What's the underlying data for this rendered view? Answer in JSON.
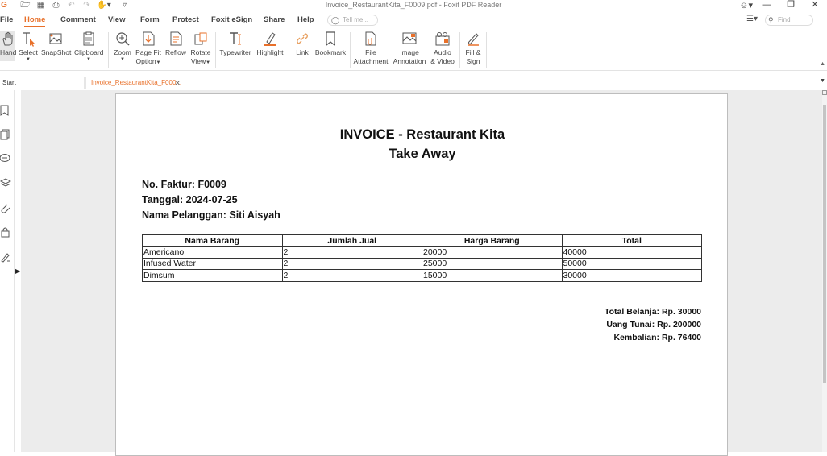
{
  "window": {
    "title": "Invoice_RestaurantKita_F0009.pdf - Foxit PDF Reader"
  },
  "menu": {
    "tabs": [
      {
        "label": "File"
      },
      {
        "label": "Home"
      },
      {
        "label": "Comment"
      },
      {
        "label": "View"
      },
      {
        "label": "Form"
      },
      {
        "label": "Protect"
      },
      {
        "label": "Foxit eSign"
      },
      {
        "label": "Share"
      },
      {
        "label": "Help"
      }
    ],
    "tell_me_placeholder": "Tell me...",
    "find_placeholder": "Find"
  },
  "ribbon": {
    "hand": "Hand",
    "select": "Select",
    "snapshot": "SnapShot",
    "clipboard": "Clipboard",
    "zoom": "Zoom",
    "page_fit_1": "Page Fit",
    "page_fit_2": "Option",
    "reflow": "Reflow",
    "rotate_1": "Rotate",
    "rotate_2": "View",
    "typewriter": "Typewriter",
    "highlight": "Highlight",
    "link": "Link",
    "bookmark": "Bookmark",
    "file_att_1": "File",
    "file_att_2": "Attachment",
    "image_ann_1": "Image",
    "image_ann_2": "Annotation",
    "audio_1": "Audio",
    "audio_2": "& Video",
    "fill_1": "Fill &",
    "fill_2": "Sign"
  },
  "tabs": {
    "start": "Start",
    "file": "Invoice_RestaurantKita_F000..."
  },
  "document": {
    "title": "INVOICE - Restaurant Kita",
    "subtitle": "Take Away",
    "no_faktur": "No. Faktur: F0009",
    "tanggal": "Tanggal: 2024-07-25",
    "pelanggan": "Nama Pelanggan: Siti Aisyah",
    "table": {
      "headers": [
        "Nama Barang",
        "Jumlah Jual",
        "Harga Barang",
        "Total"
      ],
      "rows": [
        [
          "Americano",
          "2",
          "20000",
          "40000"
        ],
        [
          "Infused Water",
          "2",
          "25000",
          "50000"
        ],
        [
          "Dimsum",
          "2",
          "15000",
          "30000"
        ]
      ]
    },
    "total_belanja": "Total Belanja: Rp. 30000",
    "uang_tunai": "Uang Tunai: Rp. 200000",
    "kembalian": "Kembalian: Rp. 76400"
  }
}
